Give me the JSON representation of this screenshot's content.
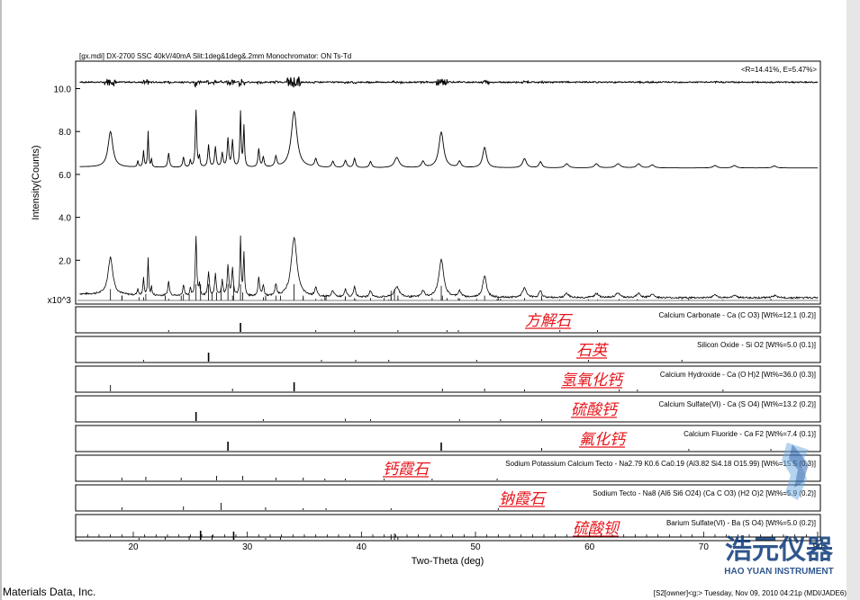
{
  "header": {
    "scan_info": "[gx.mdi] DX-2700 SSC 40kV/40mA Slit:1deg&1deg&.2mm Monochromator: ON Ts-Td",
    "fit_stats": "<R=14.41%, E=5.47%>"
  },
  "footer": {
    "vendor": "Materials Data, Inc.",
    "status": "[S2[owner]<g:> Tuesday, Nov 09, 2010 04:21p (MDI/JADE6)"
  },
  "watermark": {
    "brand_cn": "浩元仪器",
    "brand_en": "HAO YUAN INSTRUMENT"
  },
  "colors": {
    "annotation": "#e8141a",
    "trace": "#000000",
    "watermark": "#0d3a7a"
  },
  "chart_data": {
    "type": "line",
    "xlabel": "Two-Theta (deg)",
    "ylabel": "Intensity(Counts)",
    "x_ticks": [
      20,
      30,
      40,
      50,
      60,
      70,
      80
    ],
    "xlim": [
      15,
      80
    ],
    "y_ticks": [
      "2.0",
      "4.0",
      "6.0",
      "8.0",
      "10.0"
    ],
    "y_unit_label": "x10^3",
    "ylim": [
      0,
      11.1
    ],
    "grid": false,
    "baselines": {
      "measured": 0.25,
      "residual": 10.3,
      "fitted": 6.3
    },
    "peaks": [
      {
        "x": 18.0,
        "h": 1.75,
        "w": 0.25
      },
      {
        "x": 20.4,
        "h": 0.3,
        "w": 0.06
      },
      {
        "x": 20.9,
        "h": 0.8,
        "w": 0.06
      },
      {
        "x": 21.3,
        "h": 1.75,
        "w": 0.05
      },
      {
        "x": 21.6,
        "h": 0.4,
        "w": 0.05
      },
      {
        "x": 23.1,
        "h": 0.7,
        "w": 0.08
      },
      {
        "x": 24.4,
        "h": 0.5,
        "w": 0.08
      },
      {
        "x": 25.0,
        "h": 0.35,
        "w": 0.06
      },
      {
        "x": 25.5,
        "h": 2.8,
        "w": 0.07
      },
      {
        "x": 25.8,
        "h": 0.5,
        "w": 0.06
      },
      {
        "x": 26.6,
        "h": 1.1,
        "w": 0.08
      },
      {
        "x": 27.2,
        "h": 1.0,
        "w": 0.08
      },
      {
        "x": 27.8,
        "h": 0.7,
        "w": 0.08
      },
      {
        "x": 28.3,
        "h": 1.4,
        "w": 0.08
      },
      {
        "x": 28.7,
        "h": 1.3,
        "w": 0.08
      },
      {
        "x": 29.4,
        "h": 2.7,
        "w": 0.06
      },
      {
        "x": 29.7,
        "h": 2.0,
        "w": 0.06
      },
      {
        "x": 31.0,
        "h": 0.9,
        "w": 0.08
      },
      {
        "x": 31.4,
        "h": 0.5,
        "w": 0.08
      },
      {
        "x": 32.5,
        "h": 0.5,
        "w": 0.1
      },
      {
        "x": 34.1,
        "h": 2.75,
        "w": 0.3
      },
      {
        "x": 36.0,
        "h": 0.4,
        "w": 0.12
      },
      {
        "x": 37.5,
        "h": 0.3,
        "w": 0.12
      },
      {
        "x": 38.6,
        "h": 0.35,
        "w": 0.12
      },
      {
        "x": 39.4,
        "h": 0.45,
        "w": 0.1
      },
      {
        "x": 40.8,
        "h": 0.3,
        "w": 0.12
      },
      {
        "x": 43.1,
        "h": 0.5,
        "w": 0.25
      },
      {
        "x": 45.4,
        "h": 0.3,
        "w": 0.15
      },
      {
        "x": 47.0,
        "h": 1.75,
        "w": 0.25
      },
      {
        "x": 48.6,
        "h": 0.3,
        "w": 0.15
      },
      {
        "x": 50.8,
        "h": 1.0,
        "w": 0.2
      },
      {
        "x": 54.3,
        "h": 0.45,
        "w": 0.2
      },
      {
        "x": 55.7,
        "h": 0.3,
        "w": 0.15
      },
      {
        "x": 58.0,
        "h": 0.2,
        "w": 0.2
      },
      {
        "x": 60.6,
        "h": 0.2,
        "w": 0.2
      },
      {
        "x": 62.5,
        "h": 0.2,
        "w": 0.25
      },
      {
        "x": 64.3,
        "h": 0.2,
        "w": 0.2
      },
      {
        "x": 65.5,
        "h": 0.15,
        "w": 0.2
      },
      {
        "x": 71.0,
        "h": 0.12,
        "w": 0.2
      },
      {
        "x": 72.7,
        "h": 0.12,
        "w": 0.2
      },
      {
        "x": 76.2,
        "h": 0.1,
        "w": 0.2
      }
    ],
    "phases": [
      {
        "name_cn": "方解石",
        "label": "Calcium Carbonate - Ca (C O3) [Wt%=12.1 (0.2)]",
        "sticks": [
          [
            23.1,
            0.1
          ],
          [
            29.4,
            1.0
          ],
          [
            36.0,
            0.1
          ],
          [
            39.4,
            0.15
          ],
          [
            43.2,
            0.15
          ],
          [
            47.5,
            0.15
          ],
          [
            48.5,
            0.15
          ],
          [
            57.4,
            0.05
          ],
          [
            60.7,
            0.05
          ]
        ]
      },
      {
        "name_cn": "石英",
        "label": "Silicon Oxide - Si O2 [Wt%=5.0 (0.1)]",
        "sticks": [
          [
            20.9,
            0.2
          ],
          [
            26.6,
            1.0
          ],
          [
            36.5,
            0.08
          ],
          [
            39.5,
            0.06
          ],
          [
            42.4,
            0.06
          ],
          [
            50.1,
            0.1
          ],
          [
            59.9,
            0.06
          ],
          [
            68.1,
            0.06
          ]
        ]
      },
      {
        "name_cn": "氢氧化钙",
        "label": "Calcium Hydroxide - Ca (O H)2 [Wt%=36.0 (0.3)]",
        "sticks": [
          [
            18.0,
            0.7
          ],
          [
            28.7,
            0.3
          ],
          [
            34.1,
            1.0
          ],
          [
            47.1,
            0.3
          ],
          [
            50.8,
            0.3
          ],
          [
            54.3,
            0.15
          ],
          [
            62.6,
            0.08
          ],
          [
            64.2,
            0.08
          ],
          [
            71.7,
            0.05
          ]
        ]
      },
      {
        "name_cn": "硫酸钙",
        "label": "Calcium Sulfate(VI) - Ca (S O4) [Wt%=13.2 (0.2)]",
        "sticks": [
          [
            25.5,
            1.0
          ],
          [
            31.4,
            0.2
          ],
          [
            38.6,
            0.25
          ],
          [
            40.8,
            0.15
          ],
          [
            48.6,
            0.12
          ],
          [
            52.2,
            0.1
          ],
          [
            55.8,
            0.12
          ]
        ]
      },
      {
        "name_cn": "氟化钙",
        "label": "Calcium Fluoride - Ca F2 [Wt%=7.4 (0.1)]",
        "sticks": [
          [
            28.3,
            1.0
          ],
          [
            47.0,
            0.9
          ],
          [
            55.8,
            0.3
          ],
          [
            68.7,
            0.1
          ],
          [
            75.9,
            0.1
          ]
        ]
      },
      {
        "name_cn": "钙霞石",
        "label": "Sodium Potassium Calcium Tecto - Na2.79 K0.6 Ca0.19 (Al3.82 Si4.18 O15.99) [Wt%=15.5 (0.3)]",
        "sticks": [
          [
            13.9,
            0.15
          ],
          [
            19.0,
            0.3
          ],
          [
            21.1,
            0.4
          ],
          [
            24.2,
            0.3
          ],
          [
            27.3,
            0.5
          ],
          [
            29.6,
            0.5
          ],
          [
            32.5,
            0.3
          ],
          [
            34.9,
            0.3
          ],
          [
            36.8,
            0.2
          ],
          [
            38.6,
            0.2
          ],
          [
            42.0,
            0.15
          ],
          [
            46.2,
            0.15
          ],
          [
            51.9,
            0.1
          ]
        ]
      },
      {
        "name_cn": "钠霞石",
        "label": "Sodium Tecto - Na8 (Al6 Si6 O24) (Ca C O3) (H2 O)2 [Wt%=5.9 (0.2)]",
        "sticks": [
          [
            14.1,
            0.3
          ],
          [
            19.0,
            0.3
          ],
          [
            24.4,
            0.4
          ],
          [
            27.7,
            0.8
          ],
          [
            31.6,
            0.3
          ],
          [
            34.9,
            0.2
          ],
          [
            36.9,
            0.2
          ],
          [
            42.6,
            0.2
          ],
          [
            52.0,
            0.15
          ]
        ]
      },
      {
        "name_cn": "硫酸钡",
        "label": "Barium Sulfate(VI) - Ba (S O4) [Wt%=5.0 (0.2)]",
        "sticks": [
          [
            20.5,
            0.2
          ],
          [
            22.8,
            0.3
          ],
          [
            24.9,
            0.4
          ],
          [
            25.9,
            1.0
          ],
          [
            26.9,
            0.5
          ],
          [
            28.8,
            0.9
          ],
          [
            31.6,
            0.2
          ],
          [
            32.9,
            0.3
          ],
          [
            42.6,
            0.6
          ],
          [
            42.9,
            0.7
          ],
          [
            43.2,
            0.3
          ]
        ]
      }
    ]
  }
}
